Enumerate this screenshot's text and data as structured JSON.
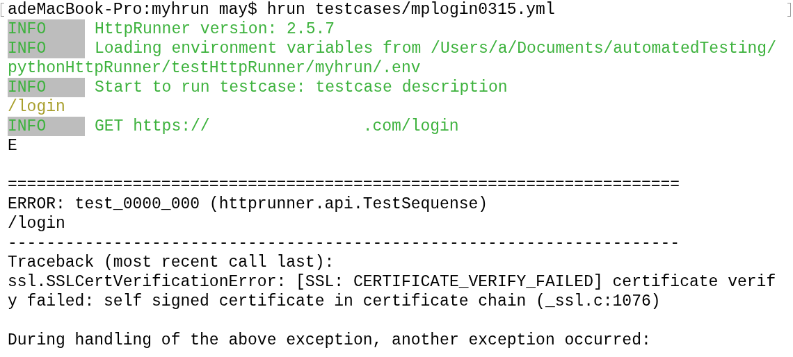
{
  "lines": [
    {
      "kind": "prompt",
      "text": "adeMacBook-Pro:myhrun may$ hrun testcases/mplogin0315.yml"
    },
    {
      "kind": "info",
      "label": "INFO",
      "text": "HttpRunner version: 2.5.7"
    },
    {
      "kind": "info",
      "label": "INFO",
      "text": "Loading environment variables from /Users/a/Documents/automatedTesting/"
    },
    {
      "kind": "info_cont",
      "text": "pythonHttpRunner/testHttpRunner/myhrun/.env"
    },
    {
      "kind": "info",
      "label": "INFO",
      "text": "Start to run testcase: testcase description"
    },
    {
      "kind": "path",
      "text": "/login"
    },
    {
      "kind": "info_redacted",
      "label": "INFO",
      "text": "GET https://",
      "text_after": ".com/login"
    },
    {
      "kind": "plain",
      "text": "E"
    },
    {
      "kind": "blank"
    },
    {
      "kind": "plain",
      "text": "======================================================================"
    },
    {
      "kind": "plain",
      "text": "ERROR: test_0000_000 (httprunner.api.TestSequense)"
    },
    {
      "kind": "plain",
      "text": "/login"
    },
    {
      "kind": "plain",
      "text": "----------------------------------------------------------------------"
    },
    {
      "kind": "plain",
      "text": "Traceback (most recent call last):"
    },
    {
      "kind": "plain",
      "text": "ssl.SSLCertVerificationError: [SSL: CERTIFICATE_VERIFY_FAILED] certificate verif"
    },
    {
      "kind": "plain",
      "text": "y failed: self signed certificate in certificate chain (_ssl.c:1076)"
    },
    {
      "kind": "blank"
    },
    {
      "kind": "plain",
      "text": "During handling of the above exception, another exception occurred:"
    }
  ]
}
